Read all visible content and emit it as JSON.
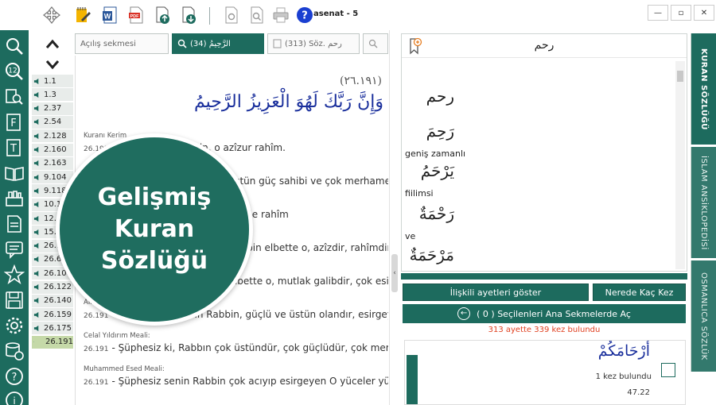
{
  "window": {
    "title": "asenat - 5",
    "controls": {
      "minimize": "—",
      "maximize": "▫",
      "close": "✕"
    }
  },
  "toolbar": {
    "icons": [
      "move-icon",
      "edit-note-icon",
      "word-export-icon",
      "pdf-export-icon",
      "upload-icon",
      "download-icon",
      "settings-page-icon",
      "search-page-icon",
      "print-icon",
      "help-icon"
    ],
    "help_label": "?"
  },
  "rail": {
    "icons": [
      "search-icon",
      "number-search-icon",
      "book-search-icon",
      "fihrist-icon",
      "text-icon",
      "books-icon",
      "library-icon",
      "notes-icon",
      "comment-icon",
      "star-icon",
      "save-icon",
      "settings-icon",
      "database-icon",
      "help-icon",
      "info-icon"
    ],
    "number_label": "12"
  },
  "verses": {
    "items": [
      "1.1",
      "1.3",
      "2.37",
      "2.54",
      "2.128",
      "2.160",
      "2.163",
      "9.104",
      "9.118",
      "10.10",
      "12.9",
      "15.4",
      "26.9",
      "26.68",
      "26.104",
      "26.122",
      "26.140",
      "26.159",
      "26.175",
      "26.191"
    ],
    "selected": "26.191"
  },
  "tabs": [
    {
      "label": "Açılış sekmesi",
      "active": false
    },
    {
      "label": "(34) الرَّحِيمُ",
      "active": true
    },
    {
      "label": "(313) Söz. رحم",
      "active": false
    }
  ],
  "content": {
    "reference": "(٢٦.١٩١)",
    "arabic": "وَإِنَّ رَبَّكَ لَهُوَ الْعَزِيزُ الرَّحِيمُ",
    "meals": [
      {
        "name": "Kuranı Kerim",
        "num": "26.191",
        "text": "Ve şüphesiz rabbin, o azîzur rahîm."
      },
      {
        "name": "",
        "num": "26.191",
        "text": "Şüphesiz senin Rabbin üstün güç sahibi ve çok merhametli olan"
      },
      {
        "name": "",
        "num": "26.191",
        "text": "Rabbin, elbette, Azîz'dir, öyle rahîm"
      },
      {
        "name": "",
        "num": "26.191",
        "text": "Ve muhakkak ki, senin Rabbin elbette o, azîzdir, rahîmdir."
      },
      {
        "name": "",
        "num": "26.191",
        "text": "Şüphesiz senin Rabbin elbette o, mutlak galibdir, çok esirgeyicidir O."
      },
      {
        "name": "Ali Bulaç Meali:",
        "num": "26.191",
        "text": "Ve şüphesiz senin Rabbin, güçlü ve üstün olandır, esirgeyendir."
      },
      {
        "name": "Celal Yıldırım Meali:",
        "num": "26.191",
        "text": "Şüphesiz ki, Rabbın çok üstündür, çok güçlüdür, çok merhamet sa"
      },
      {
        "name": "Muhammed Esed Meali:",
        "num": "26.191",
        "text": "Şüphesiz senin Rabbin çok acıyıp esirgeyen O yüceler yücesidir!"
      }
    ]
  },
  "dictionary": {
    "word": "رحم",
    "entries": [
      {
        "arabic": "رحم",
        "text": ""
      },
      {
        "arabic": "رَحِمَ",
        "text": "geniş zamanlı"
      },
      {
        "arabic": "يَرْحَمُ",
        "text": "fiilimsi"
      },
      {
        "arabic": "رَحْمَةٌ",
        "text": "ve"
      },
      {
        "arabic": "مَرْحَمَةٌ",
        "text": ""
      }
    ],
    "buttons": {
      "related": "İlişkili ayetleri göster",
      "where": "Nerede Kaç Kez",
      "open_selected": "( 0 ) Seçilenleri Ana Sekmelerde Aç"
    },
    "found": "313 ayette 339 kez bulundu",
    "result": {
      "arabic": "أَرْحَامَكُمْ",
      "count": "1 kez bulundu",
      "ref": "47.22"
    }
  },
  "side_tabs": {
    "items": [
      {
        "label": "KURAN SÖZLÜĞÜ",
        "active": true
      },
      {
        "label": "İSLAM ANSİKLOPEDİSİ",
        "active": false
      },
      {
        "label": "OSMANLICA SÖZLÜK",
        "active": false
      }
    ]
  },
  "badge": {
    "lines": [
      "Gelişmiş",
      "Kuran",
      "Sözlüğü"
    ]
  },
  "colors": {
    "accent": "#1d6b5e",
    "arabic_text": "#1a2f9c",
    "found_text": "#e04020",
    "selected_verse": "#c5d9a8"
  }
}
